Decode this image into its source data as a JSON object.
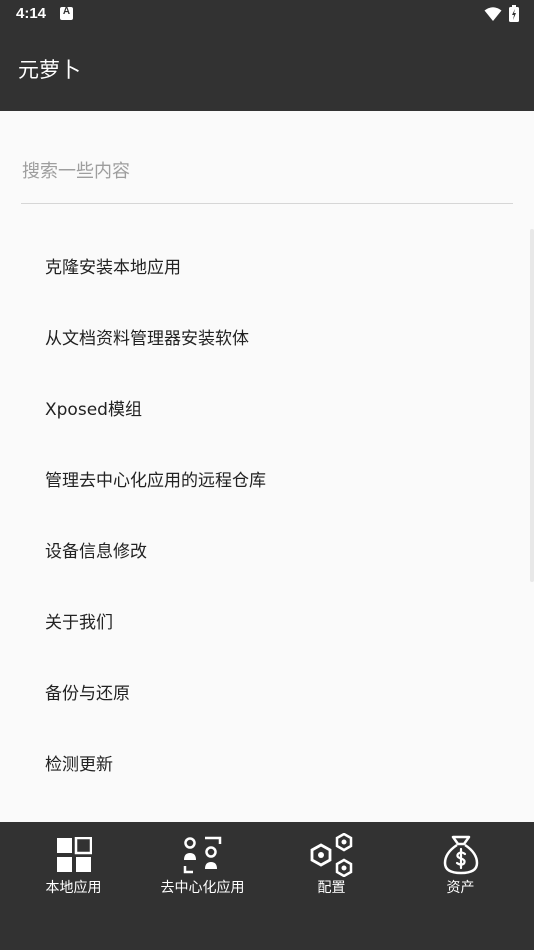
{
  "status_bar": {
    "time": "4:14"
  },
  "app_bar": {
    "title": "元萝卜"
  },
  "search": {
    "placeholder": "搜索一些内容",
    "value": ""
  },
  "menu": {
    "items": [
      {
        "label": "克隆安装本地应用"
      },
      {
        "label": "从文档资料管理器安装软体"
      },
      {
        "label": "Xposed模组"
      },
      {
        "label": "管理去中心化应用的远程仓库"
      },
      {
        "label": "设备信息修改"
      },
      {
        "label": "关于我们"
      },
      {
        "label": "备份与还原"
      },
      {
        "label": "检测更新"
      }
    ]
  },
  "bottom_nav": {
    "tabs": [
      {
        "label": "本地应用",
        "icon": "grid-apps-icon"
      },
      {
        "label": "去中心化应用",
        "icon": "decentralized-apps-icon"
      },
      {
        "label": "配置",
        "icon": "hexagon-nodes-icon"
      },
      {
        "label": "资产",
        "icon": "money-bag-icon"
      }
    ]
  },
  "colors": {
    "bar_background": "#323232",
    "content_background": "#fafafa",
    "text_primary": "#222222",
    "placeholder": "#9e9e9e"
  }
}
